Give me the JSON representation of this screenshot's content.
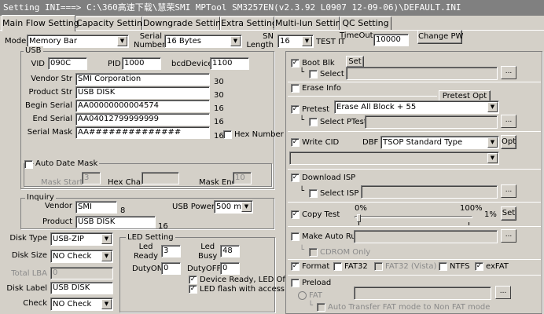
{
  "window": {
    "title": "Setting  INI===> C:\\360高速下载\\慧荣SMI MPTool SM3257EN(v2.3.92 L0907 12-09-06)\\DEFAULT.INI"
  },
  "tabs": [
    "Main Flow Setting",
    "Capacity Setting",
    "Downgrade Setting",
    "Extra Setting",
    "Multi-lun Setting",
    "QC Setting"
  ],
  "top": {
    "mode_label": "Mode",
    "mode_value": "Memory Bar",
    "serial_label": "Serial\nNumber",
    "serial_value": "16 Bytes",
    "sn_label": "SN\nLength",
    "sn_value": "16",
    "test_label": "TEST IT",
    "timeout_label": "TimeOut",
    "timeout_value": "10000",
    "change_pw": "Change PW"
  },
  "usb": {
    "title": "USB",
    "vid_label": "VID",
    "vid": "090C",
    "pid_label": "PID",
    "pid": "1000",
    "bcd_label": "bcdDevice",
    "bcd": "1100",
    "vendor_label": "Vendor Str",
    "vendor": "SMI Corporation",
    "vendor_len": "30",
    "product_label": "Product Str",
    "product": "USB DISK",
    "product_len": "30",
    "begin_label": "Begin Serial",
    "begin": "AA00000000004574",
    "begin_len": "16",
    "end_label": "End Serial",
    "end": "AA04012799999999",
    "end_len": "16",
    "mask_label": "Serial Mask",
    "mask": "AA##############",
    "mask_len": "16",
    "hex_label": "Hex Number",
    "auto_label": "Auto Date Mask",
    "mask_start_label": "Mask Start",
    "mask_start": "3",
    "hex_char_label": "Hex Char:",
    "mask_end_label": "Mask End",
    "mask_end": "10"
  },
  "inquiry": {
    "title": "Inquiry",
    "vendor_label": "Vendor",
    "vendor": "SMI",
    "vendor_len": "8",
    "product_label": "Product",
    "product": "USB DISK",
    "product_len": "16",
    "power_label": "USB Power",
    "power": "500 mA"
  },
  "disk": {
    "type_label": "Disk Type",
    "type": "USB-ZIP",
    "size_label": "Disk Size",
    "size": "NO Check",
    "lba_label": "Total LBA",
    "lba": "0",
    "label_label": "Disk Label",
    "label": "USB DISK",
    "check_label": "Check",
    "check": "NO Check"
  },
  "led": {
    "title": "LED Setting",
    "ready_label": "Led\nReady",
    "ready": "3",
    "busy_label": "Led\nBusy",
    "busy": "48",
    "dutyon_label": "DutyON",
    "dutyon": "0",
    "dutyoff_label": "DutyOFF",
    "dutyoff": "0",
    "device_ready": "Device Ready, LED Of",
    "flash": "LED flash with access"
  },
  "right": {
    "boot_label": "Boot Blk",
    "set": "Set",
    "select": "Select",
    "erase_label": "Erase Info",
    "pretest_opt": "Pretest Opt",
    "pretest_label": "Pretest",
    "pretest_value": "Erase All Block + 55",
    "select_ptest": "Select PTest",
    "writecid_label": "Write CID",
    "dbf_label": "DBF",
    "dbf_value": "TSOP Standard Type",
    "opt": "Opt",
    "download_label": "Download ISP",
    "select_isp": "Select ISP",
    "copy_label": "Copy Test",
    "pct0": "0%",
    "pct100": "100%",
    "pct": "1%",
    "copy_set": "Set",
    "autorun_label": "Make Auto Run",
    "cdrom_label": "CDROM Only",
    "format_label": "Format",
    "fat32": "FAT32",
    "fat32v": "FAT32 (Vista)",
    "ntfs": "NTFS",
    "exfat": "exFAT",
    "preload_label": "Preload",
    "fat_label": "FAT",
    "autotransfer": "Auto Transfer FAT mode to Non FAT mode",
    "ellipsis": "..."
  },
  "check_mark": "✓",
  "arrow": "▼"
}
